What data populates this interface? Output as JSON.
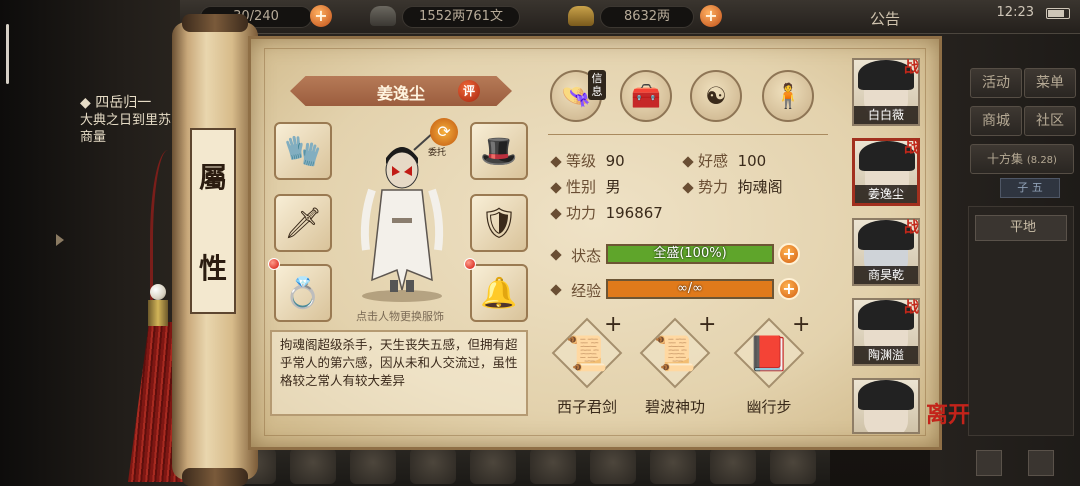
{
  "topbar": {
    "stamina": "30/240",
    "money": "1552两761文",
    "gold": "8632两",
    "announcement": "公告",
    "time": "12:23"
  },
  "quest": {
    "title": "四岳归一",
    "text": "大典之日到里苏商量"
  },
  "scroll": {
    "label_top": "屬",
    "label_bottom": "性"
  },
  "character": {
    "name": "姜逸尘",
    "rate_label": "评",
    "swap_label": "委托",
    "hint": "点击人物更换服饰",
    "description": "拘魂阁超级杀手，天生丧失五感，但拥有超乎常人的第六感，因从未和人交流过，虽性格较之常人有较大差异"
  },
  "tabs": {
    "info_label": "信息"
  },
  "stats": {
    "level_label": "等级",
    "level": "90",
    "favor_label": "好感",
    "favor": "100",
    "gender_label": "性别",
    "gender": "男",
    "faction_label": "势力",
    "faction": "拘魂阁",
    "power_label": "功力",
    "power": "196867"
  },
  "bars": {
    "status_label": "状态",
    "status_text": "全盛(100%)",
    "status_fill": 1.0,
    "exp_label": "经验",
    "exp_text": "∞/∞",
    "exp_fill": 1.0
  },
  "skills": [
    {
      "name": "西子君剑"
    },
    {
      "name": "碧波神功"
    },
    {
      "name": "幽行步"
    }
  ],
  "roster": [
    {
      "name": "白白薇",
      "tag": "战"
    },
    {
      "name": "姜逸尘",
      "tag": "战"
    },
    {
      "name": "商昊乾",
      "tag": "战"
    },
    {
      "name": "陶渊溢",
      "tag": "战"
    },
    {
      "name": "",
      "tag": ""
    }
  ],
  "leave_label": "离开",
  "sidebar": {
    "activity": "活动",
    "menu": "菜单",
    "shop": "商城",
    "community": "社区",
    "market": "十方集",
    "market_date": "(8.28)",
    "tab": "子 五",
    "terrain": "平地"
  },
  "colors": {
    "status_bar": "#5fa52b",
    "exp_bar": "#e07a1b",
    "accent_red": "#c3271a"
  }
}
